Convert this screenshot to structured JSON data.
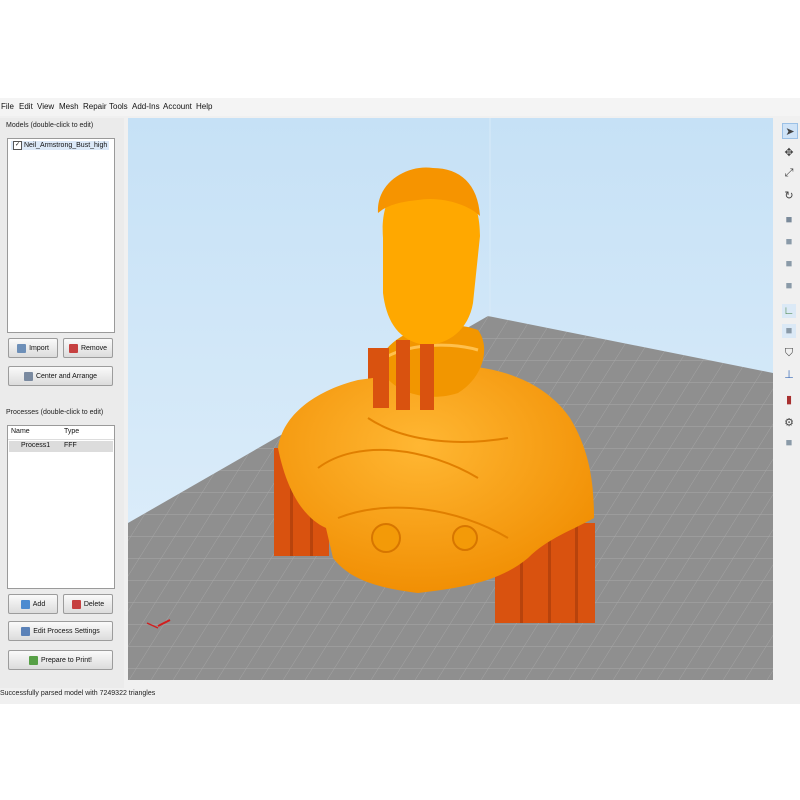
{
  "menu": [
    "File",
    "Edit",
    "View",
    "Mesh",
    "Repair",
    "Tools",
    "Add-Ins",
    "Account",
    "Help"
  ],
  "models_panel": {
    "label": "Models (double-click to edit)",
    "items": [
      {
        "name": "Neil_Armstrong_Bust_high",
        "checked": true
      }
    ],
    "import_label": "Import",
    "remove_label": "Remove",
    "center_label": "Center and Arrange"
  },
  "processes_panel": {
    "label": "Processes (double-click to edit)",
    "columns": [
      "Name",
      "Type"
    ],
    "rows": [
      {
        "name": "Process1",
        "type": "FFF"
      }
    ],
    "add_label": "Add",
    "delete_label": "Delete",
    "edit_label": "Edit Process Settings",
    "prepare_label": "Prepare to Print!"
  },
  "status_text": "Successfully parsed model with 7249322 triangles",
  "colors": {
    "model": "#ffa000",
    "support": "#d95015",
    "bed": "#8c8c8c",
    "sky": "#cfe6f7"
  },
  "toolbar_icons": [
    "select-icon",
    "move-icon",
    "scale-icon",
    "rotate-icon",
    "view-iso-icon",
    "view-front-icon",
    "view-left-icon",
    "view-right-icon",
    "axes-icon",
    "view-bottom-icon",
    "shield-icon",
    "origin-icon",
    "cut-icon",
    "settings-icon",
    "cube-icon"
  ]
}
